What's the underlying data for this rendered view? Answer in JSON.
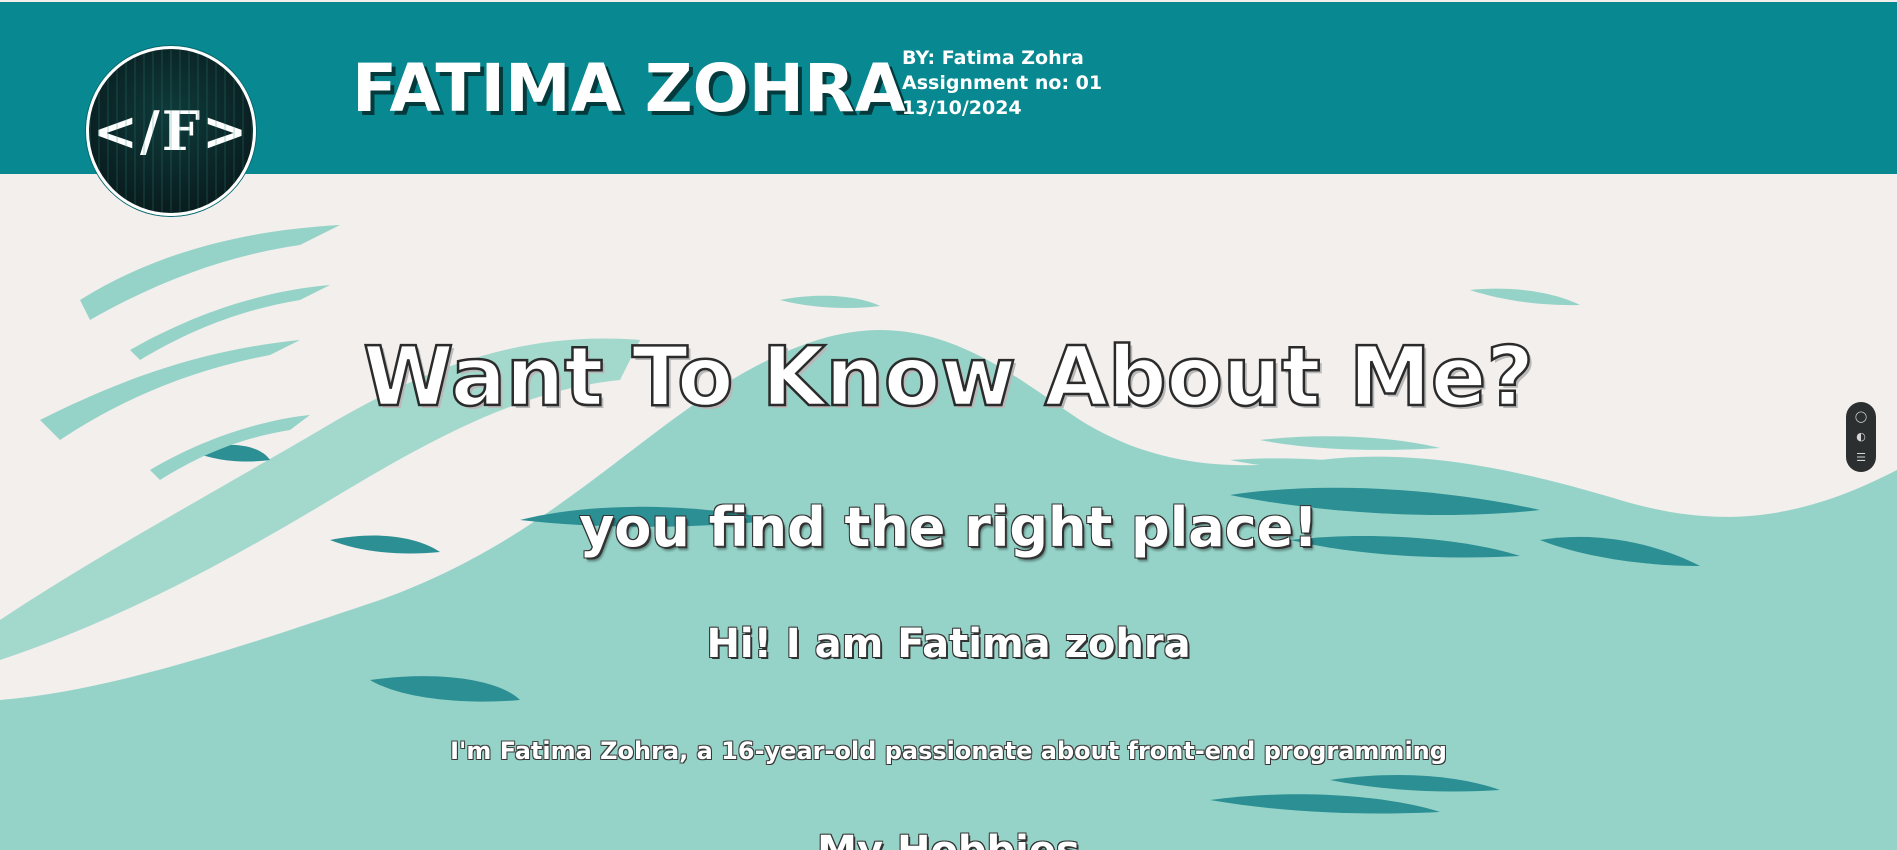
{
  "header": {
    "logo_text": "</F>",
    "site_title": "FATIMA ZOHRA",
    "meta": {
      "by": "BY: Fatima Zohra",
      "assignment": "Assignment no: 01",
      "date": "13/10/2024"
    }
  },
  "hero": {
    "heading": "Want To Know About Me?",
    "subheading": "you find the right place!",
    "greeting": "Hi! I am Fatima zohra",
    "intro": "I'm Fatima Zohra, a 16-year-old passionate about front-end programming",
    "next_heading": "My Hobbies"
  },
  "side_widget": {
    "icons": [
      "chat-icon",
      "toggle-icon",
      "settings-icon"
    ],
    "glyphs": [
      "◯",
      "◐",
      "☰"
    ]
  },
  "colors": {
    "header_bg": "#088890",
    "page_bg": "#f2efec",
    "paint_light": "#95d3c8",
    "paint_dark": "#2b8f94"
  }
}
